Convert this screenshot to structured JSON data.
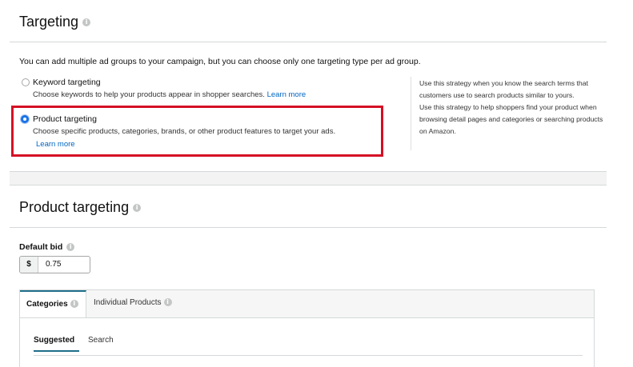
{
  "targeting": {
    "title": "Targeting",
    "intro": "You can add multiple ad groups to your campaign, but you can choose only one targeting type per ad group.",
    "options": [
      {
        "label": "Keyword targeting",
        "description": "Choose keywords to help your products appear in shopper searches.",
        "link": "Learn more",
        "selected": false
      },
      {
        "label": "Product targeting",
        "description": "Choose specific products, categories, brands, or other product features to target your ads.",
        "link": "Learn more",
        "selected": true
      }
    ],
    "help": {
      "keyword": "Use this strategy when you know the search terms that customers use to search products similar to yours.",
      "product": "Use this strategy to help shoppers find your product when browsing detail pages and categories or searching products on Amazon."
    }
  },
  "product_targeting": {
    "title": "Product targeting",
    "default_bid_label": "Default bid",
    "currency": "$",
    "bid_value": "0.75",
    "tabs": [
      {
        "label": "Categories",
        "active": true
      },
      {
        "label": "Individual Products",
        "active": false
      }
    ],
    "subtabs": [
      {
        "label": "Suggested",
        "active": true
      },
      {
        "label": "Search",
        "active": false
      }
    ]
  },
  "colors": {
    "accent": "#1a73e8",
    "highlight": "#d50f25",
    "link": "#0066c0"
  }
}
